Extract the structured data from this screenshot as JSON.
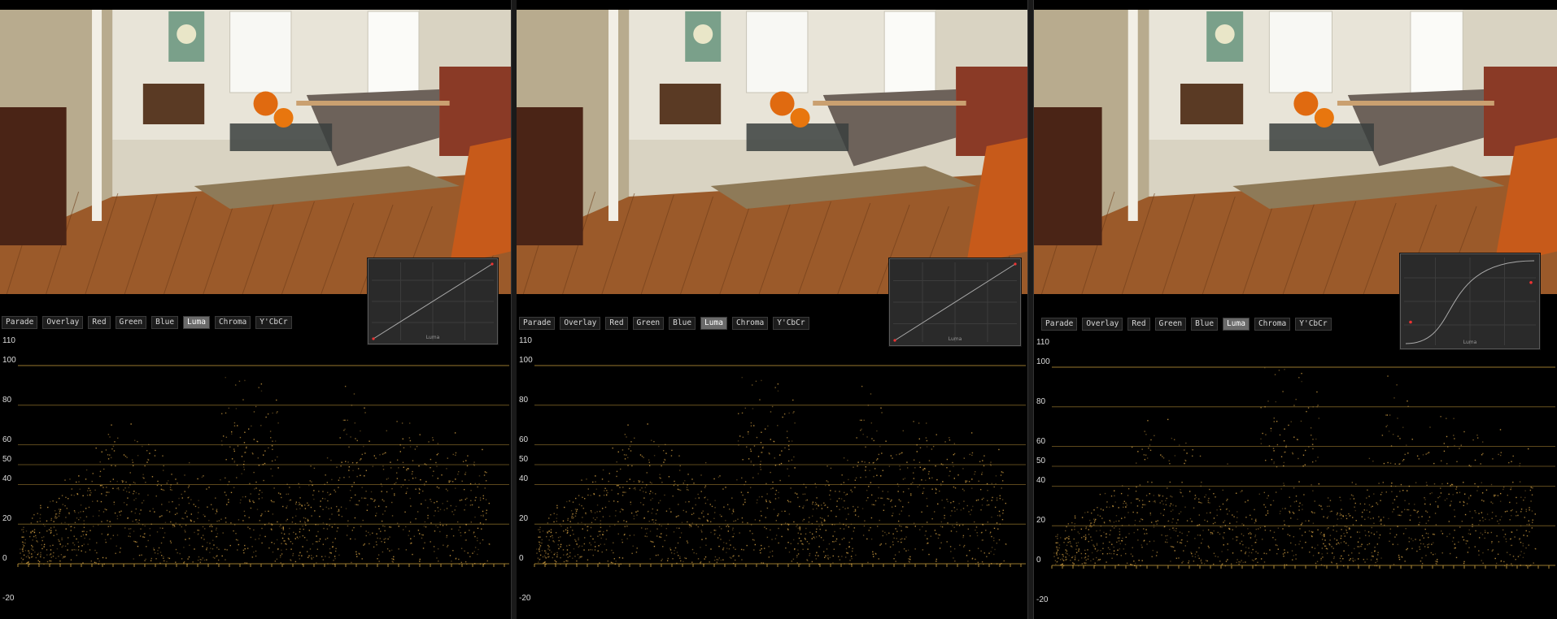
{
  "scope_buttons": [
    "Parade",
    "Overlay",
    "Red",
    "Green",
    "Blue",
    "Luma",
    "Chroma",
    "Y'CbCr"
  ],
  "active_button": "Luma",
  "scale_labels": [
    "110",
    "100",
    "80",
    "60",
    "50",
    "40",
    "20",
    "0",
    "-20"
  ],
  "curve_label": "Luma",
  "panels": [
    {
      "name": "panel-original",
      "curve": "linear"
    },
    {
      "name": "panel-linear",
      "curve": "linear"
    },
    {
      "name": "panel-s-curve",
      "curve": "s-curve"
    }
  ],
  "colors": {
    "waveform": "#e8b04a",
    "gridline": "#b08a35",
    "floor": "#8a5a2a",
    "wall": "#e6e2d6"
  }
}
